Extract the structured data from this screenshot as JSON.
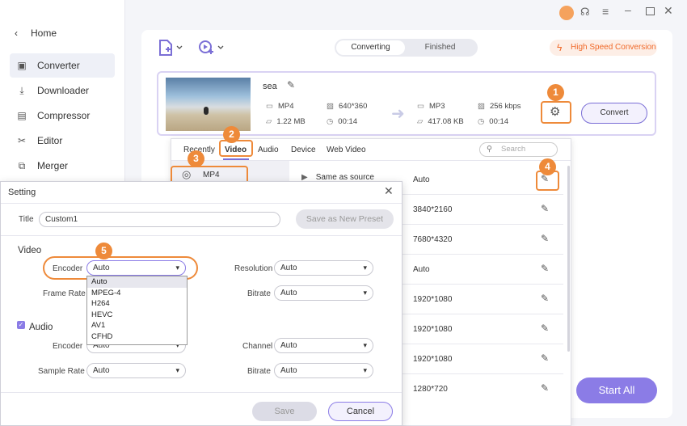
{
  "titlebar": {
    "icons": [
      "user-avatar-icon",
      "headset-icon",
      "menu-icon",
      "minimize-icon",
      "maximize-icon",
      "close-icon"
    ]
  },
  "sidebar": {
    "home": "Home",
    "items": [
      {
        "label": "Converter",
        "icon": "converter-icon",
        "active": true
      },
      {
        "label": "Downloader",
        "icon": "downloader-icon"
      },
      {
        "label": "Compressor",
        "icon": "compressor-icon"
      },
      {
        "label": "Editor",
        "icon": "editor-icon"
      },
      {
        "label": "Merger",
        "icon": "merger-icon"
      }
    ]
  },
  "toolbar": {
    "tabs": [
      "Converting",
      "Finished"
    ],
    "high_speed": "High Speed Conversion"
  },
  "file": {
    "name": "sea",
    "src_format": "MP4",
    "src_resolution": "640*360",
    "src_size": "1.22 MB",
    "src_duration": "00:14",
    "dst_format": "MP3",
    "dst_bitrate": "256 kbps",
    "dst_size": "417.08 KB",
    "dst_duration": "00:14",
    "convert": "Convert"
  },
  "badges": [
    "1",
    "2",
    "3",
    "4",
    "5"
  ],
  "format_panel": {
    "tabs": [
      "Recently",
      "Video",
      "Audio",
      "Device",
      "Web Video"
    ],
    "search_placeholder": "Search",
    "format_item": "MP4",
    "rows": [
      {
        "name": "Same as source",
        "value": "Auto"
      },
      {
        "value": "3840*2160"
      },
      {
        "value": "7680*4320"
      },
      {
        "value": "Auto"
      },
      {
        "value": "1920*1080"
      },
      {
        "value": "1920*1080"
      },
      {
        "value": "1920*1080"
      },
      {
        "value": "1280*720"
      }
    ]
  },
  "start_all": "Start All",
  "setting": {
    "title": "Setting",
    "title_label": "Title",
    "title_value": "Custom1",
    "save_preset": "Save as New Preset",
    "video_section": "Video",
    "encoder_label": "Encoder",
    "encoder_value": "Auto",
    "encoder_options": [
      "Auto",
      "MPEG-4",
      "H264",
      "HEVC",
      "AV1",
      "CFHD"
    ],
    "framerate_label": "Frame Rate",
    "resolution_label": "Resolution",
    "resolution_value": "Auto",
    "bitrate_label": "Bitrate",
    "bitrate_value": "Auto",
    "audio_section": "Audio",
    "audio_encoder_label": "Encoder",
    "audio_encoder_value": "Auto",
    "channel_label": "Channel",
    "channel_value": "Auto",
    "samplerate_label": "Sample Rate",
    "samplerate_value": "Auto",
    "audio_bitrate_label": "Bitrate",
    "audio_bitrate_value": "Auto",
    "save": "Save",
    "cancel": "Cancel"
  },
  "colors": {
    "accent": "#8b7ce6",
    "badge": "#ee8a3a",
    "high_speed": "#f06a2a"
  }
}
